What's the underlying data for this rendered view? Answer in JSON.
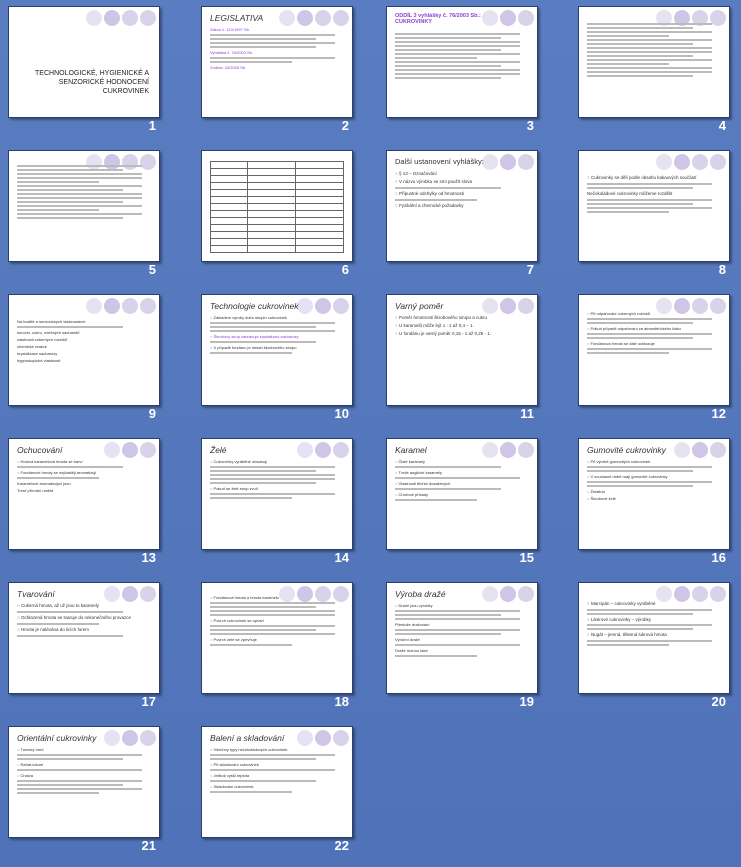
{
  "slides": [
    {
      "num": "1",
      "title": "TECHNOLOGICKÉ, HYGIENICKÉ A SENZORICKÉ HODNOCENÍ CUKROVINEK"
    },
    {
      "num": "2",
      "title": "LEGISLATIVA",
      "lead": "Zákon č. 110/1997 Sb.",
      "sub": "Vyhláška č. 76/2003 Sb.",
      "extra": "Změna: 43/2005 Sb."
    },
    {
      "num": "3",
      "title": "ODDÍL 3 vyhlášky č. 76/2003 Sb.: CUKROVINKY"
    },
    {
      "num": "4",
      "title": ""
    },
    {
      "num": "5",
      "title": ""
    },
    {
      "num": "6",
      "title": ""
    },
    {
      "num": "7",
      "title": "Další ustanovení vyhlášky:",
      "points": [
        "§ 13 – Označování",
        "V názvu výrobku se smí použít slova",
        "Přípustné odchylky od hmotnosti",
        "Fyzikální a chemické požadavky"
      ]
    },
    {
      "num": "8",
      "title": "",
      "points": [
        "Cukrovinky se dělí podle obsahu kakaových součástí",
        "Nečokoládové cukrovinky můžeme rozdělit"
      ]
    },
    {
      "num": "9",
      "title": "",
      "points": [
        "Na kvalitě a senzorických vlastnostech",
        "surovin, cukru, mléčných sacharidů",
        "vlastnosti cukerných roztoků",
        "chemické reakce",
        "krystalizace sacharózy",
        "hygroskopické vlastnosti"
      ]
    },
    {
      "num": "10",
      "title": "Technologie cukrovinek",
      "points": [
        "Základem výroby dobu skupin cukrovinek",
        "Škrobový sirup zabraňuje krystalizaci sacharózy",
        "V případě fondánu je obsah škrobového sirupu"
      ]
    },
    {
      "num": "11",
      "title": "Varný poměr",
      "points": [
        "Poměr hmotnosti škrobového sirupu a cukru",
        "U karamelů může být 1 : 1 až 0,4 – 1.",
        "U fondánu je varný poměr 0,15 - 1 až 0,25 - 1."
      ]
    },
    {
      "num": "12",
      "title": "",
      "points": [
        "Při odpařování cukerných roztoků",
        "Pokud případě odpařování za atmosférického tlaku",
        "Fondánová hmota se dále ochlazuje"
      ]
    },
    {
      "num": "13",
      "title": "Ochucování",
      "points": [
        "Hotová karamelová hmota se barví",
        "Fondánové hmoty se nejčastěji aromatizují",
        "Karamelové aromatizující jsou",
        "Tresť přírodní umělá"
      ]
    },
    {
      "num": "14",
      "title": "Želé",
      "points": [
        "Cukrovinky vyráběné obsahují",
        "Pokud se želé sirup zvolí"
      ]
    },
    {
      "num": "15",
      "title": "Karamel",
      "points": [
        "Čisté karamely",
        "Tvrdé anglické karamely",
        "Vlastnosti těchto dosažených",
        "Chuťové přísady"
      ]
    },
    {
      "num": "16",
      "title": "Gumovité cukrovinky",
      "points": [
        "Při výrobě gumovitých cukrovinek",
        "V současné době mají gumovité cukrovinky",
        "Želatina",
        "Škrobové želé"
      ]
    },
    {
      "num": "17",
      "title": "Tvarování",
      "points": [
        "Cukerná hmota, až už jsou to karamely",
        "Ochlazená hmota se tvaruje do nekonečného provazce",
        "Hmota je nalévána do licích forem"
      ]
    },
    {
      "num": "18",
      "title": "",
      "points": [
        "Fondánová hmota a hmota karamelu",
        "Povrch cukrovinek se upraví",
        "Povrch želé se zpevňuje"
      ]
    },
    {
      "num": "19",
      "title": "Výroba dražé",
      "points": [
        "Dražé jsou výrobky",
        "Přestože dražování",
        "Výrobní dražé",
        "Dražé mohou také"
      ]
    },
    {
      "num": "20",
      "title": "",
      "points": [
        "Marcipán – cukrovinky vyráběné",
        "Likérové cukrovinky – výrobky",
        "Nugát – jemná, tělesná lukrová hmota"
      ]
    },
    {
      "num": "21",
      "title": "Orientální cukrovinky",
      "points": [
        "Turecký med",
        "Rahat-lokum",
        "Chalva"
      ]
    },
    {
      "num": "22",
      "title": "Balení a skladování",
      "points": [
        "Všechny typy nečokoládových cukrovinek",
        "Při skladování cukrovinek",
        "Jelikož vyšší teplota",
        "Skladování cukrovinek"
      ]
    }
  ]
}
